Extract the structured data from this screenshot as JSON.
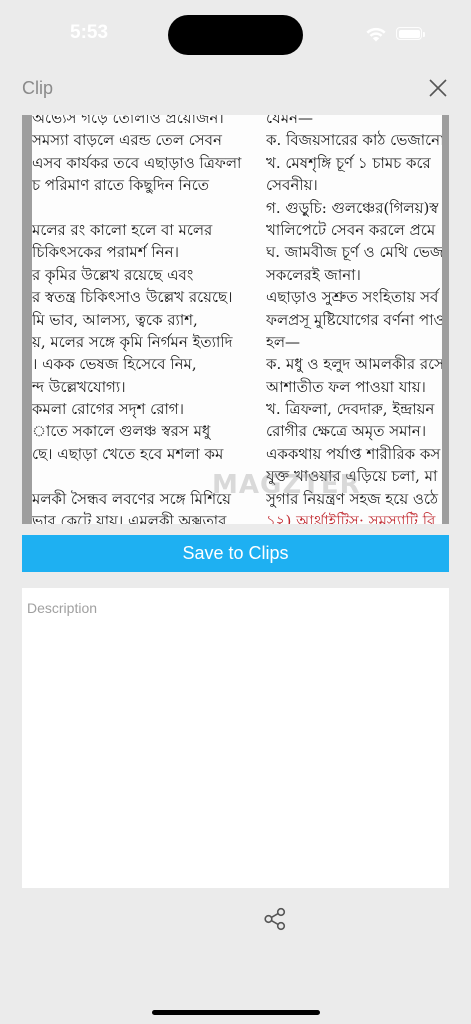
{
  "status_bar": {
    "time": "5:53"
  },
  "header": {
    "title": "Clip",
    "close_icon": "close-x-icon"
  },
  "clip": {
    "left_column": [
      "অভ্যেস গড়ে তোলাও প্রয়োজন।",
      "সমস্যা বাড়লে এরন্ড তেল সেবন",
      "এসব কার্যকর তবে এছাড়াও ত্রিফলা",
      "চ পরিমাণ রাতে কিছুদিন নিতে",
      "",
      "মলের রং কালো হলে বা মলের",
      "চিকিৎসকের পরামর্শ নিন।",
      "র কৃমির উল্লেখ রয়েছে এবং",
      "র স্বতন্ত্র চিকিৎসাও উল্লেখ রয়েছে।",
      "মি ভাব, আলস্য, ত্বকে র‍্যাশ,",
      "য়, মলের সঙ্গে কৃমি নির্গমন ইত্যাদি",
      "। একক ভেষজ হিসেবে নিম,",
      "ন্দ উল্লেখযোগ্য।",
      "কমলা রোগের সদৃশ রোগ।",
      "াতে সকালে গুলঞ্চ স্বরস মধু",
      "ছে। এছাড়া খেতে হবে মশলা কম",
      "",
      "মলকী সৈন্ধব লবণের সঙ্গে মিশিয়ে",
      "ভার কেটে যায়। এমলকী অক্সতার"
    ],
    "right_column": [
      "যেমন—",
      "ক. বিজয়সারের কাঠ ভেজানো",
      "খ. মেষশৃঙ্গি চূর্ণ ১ চামচ করে",
      "সেবনীয়।",
      "গ. গুড়ুচি: গুলঞ্চের(গিলয়)স্ব",
      "খালিপেটে সেবন করলে প্রমে",
      "ঘ. জামবীজ চূর্ণ ও মেথি ভেজা",
      "সকলেরই জানা।",
      "এছাড়াও সুশ্রুত সংহিতায় সর্ব",
      "ফলপ্রসূ মুষ্টিযোগের বর্ণনা পাও",
      "হল—",
      "ক. মধু ও হলুদ আমলকীর রসে",
      "আশাতীত ফল পাওয়া যায়।",
      "খ. ত্রিফলা, দেবদারু, ইন্দ্রায়ন",
      "রোগীর ক্ষেত্রে অমৃত সমান।",
      "এককথায় পর্যাপ্ত শারীরিক কস",
      "যুক্ত খাওয়ার এড়িয়ে চলা, মা",
      "সুগার নিয়ন্ত্রণ সহজ হয়ে ওঠে",
      "১২) আর্থ্রাইটিস: সমস্যাটি বি"
    ],
    "watermark": "MAGZTER"
  },
  "save_button": {
    "label": "Save to Clips",
    "color": "#1eb0f2"
  },
  "description": {
    "placeholder": "Description",
    "value": ""
  },
  "share": {
    "icon": "share-icon"
  }
}
